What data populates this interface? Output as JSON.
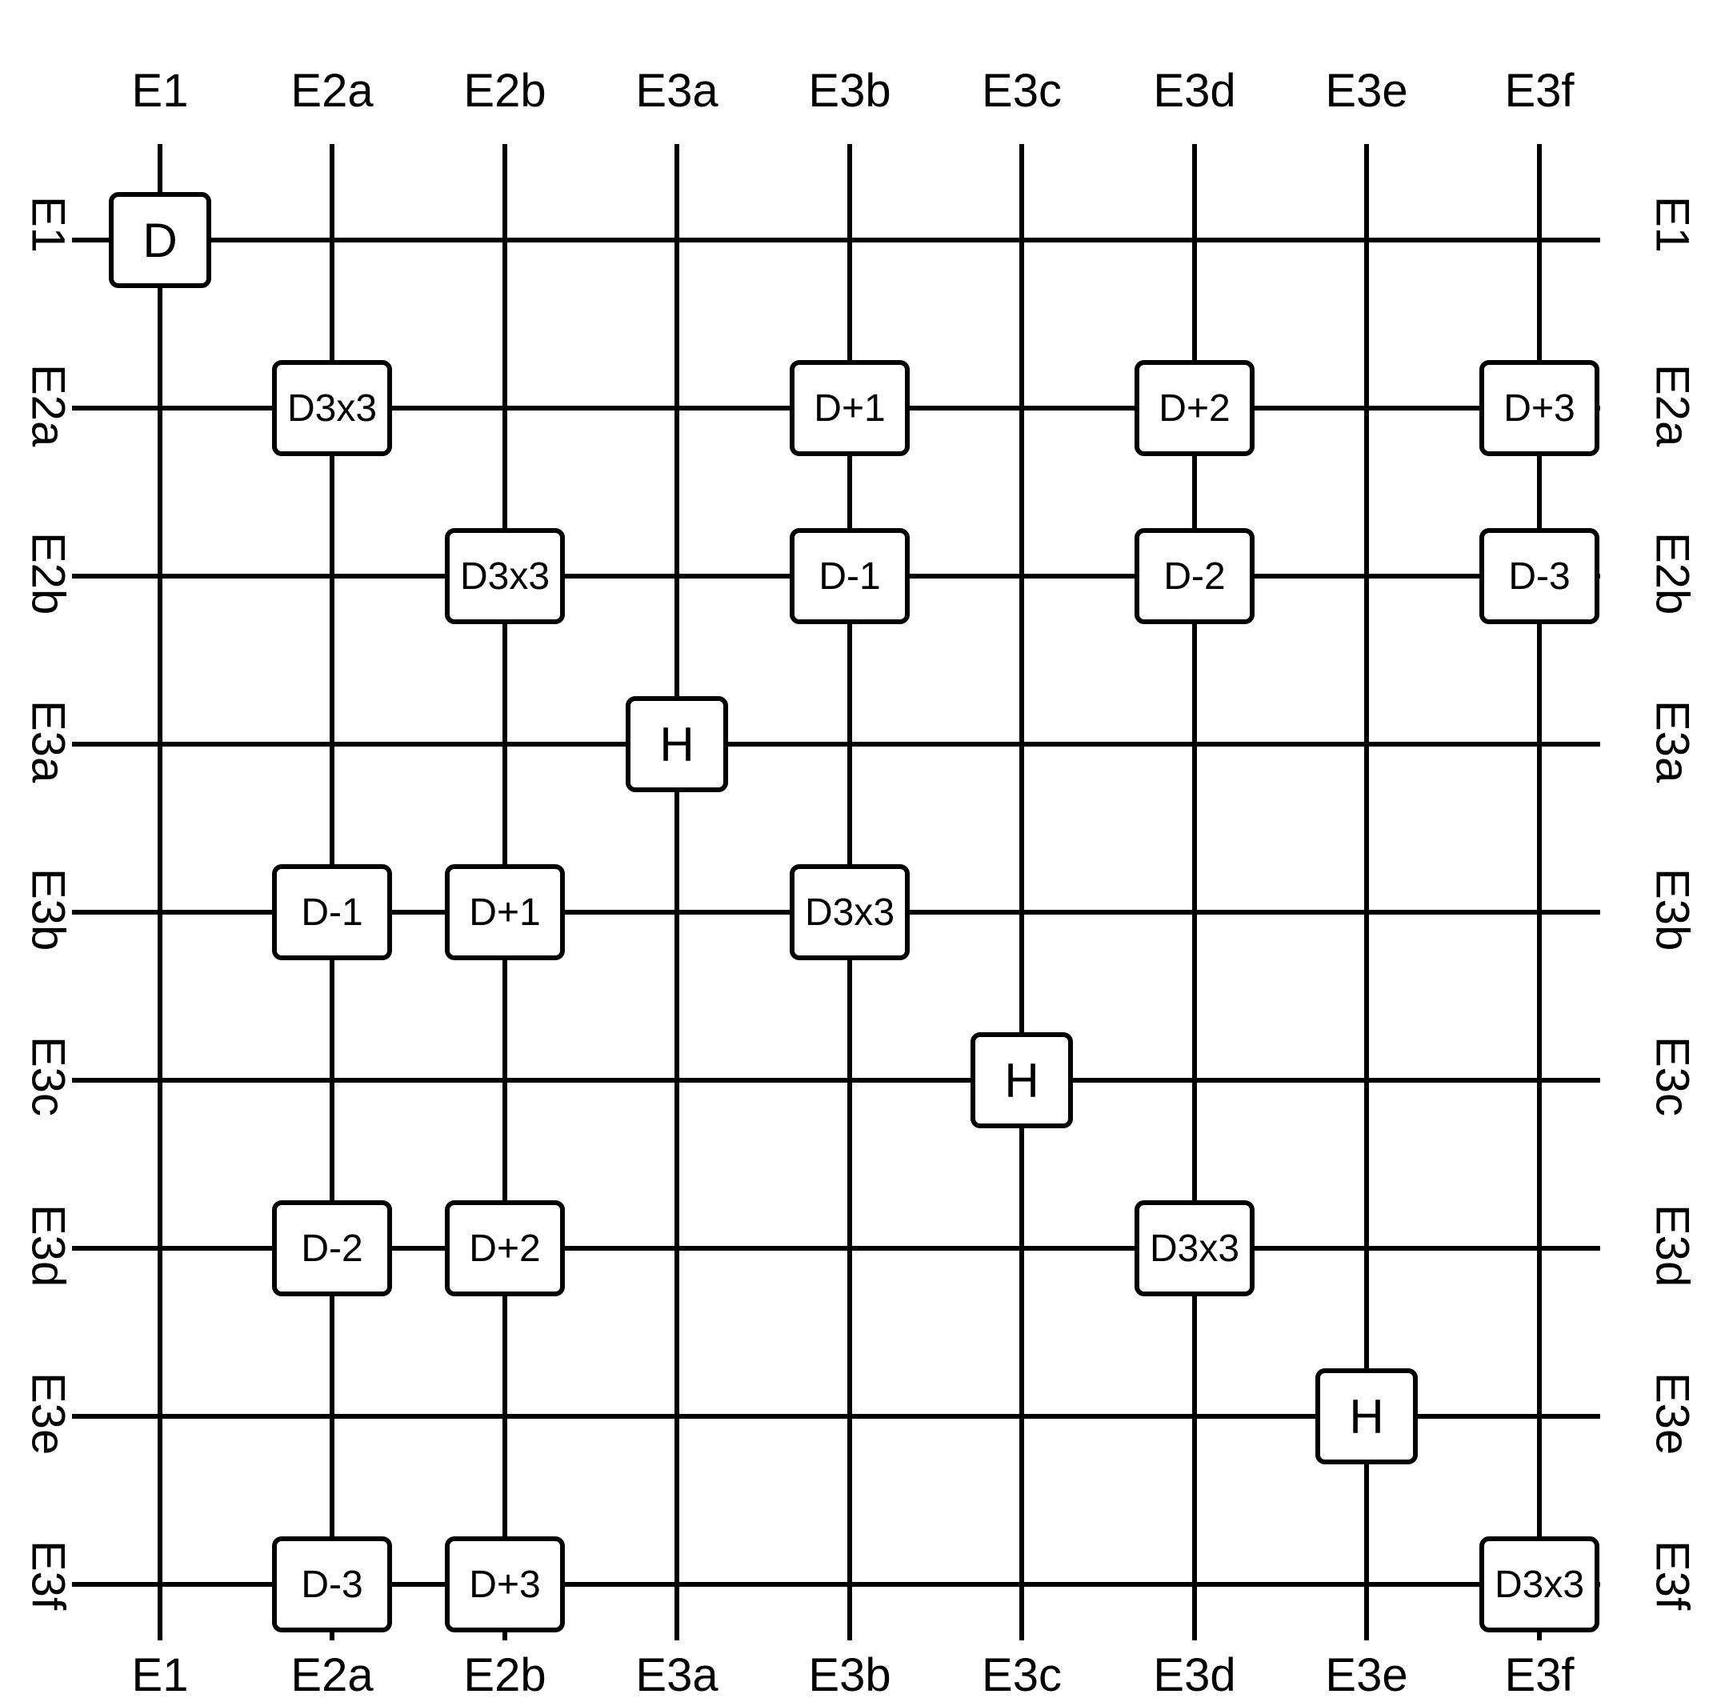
{
  "labels": [
    "E1",
    "E2a",
    "E2b",
    "E3a",
    "E3b",
    "E3c",
    "E3d",
    "E3e",
    "E3f"
  ],
  "colX": [
    200,
    415,
    631,
    846,
    1062,
    1277,
    1493,
    1708,
    1924
  ],
  "rowY": [
    300,
    510,
    720,
    930,
    1140,
    1350,
    1560,
    1770,
    1980
  ],
  "gridLeft": 90,
  "gridRight": 2000,
  "gridTop": 180,
  "gridBottom": 2050,
  "labelTopY": 80,
  "labelBottomY": 2060,
  "labelLeftX": 60,
  "labelRightX": 2090,
  "nodes": [
    {
      "r": 0,
      "c": 0,
      "t": "D",
      "big": true
    },
    {
      "r": 1,
      "c": 1,
      "t": "D3x3"
    },
    {
      "r": 1,
      "c": 4,
      "t": "D+1"
    },
    {
      "r": 1,
      "c": 6,
      "t": "D+2"
    },
    {
      "r": 1,
      "c": 8,
      "t": "D+3"
    },
    {
      "r": 2,
      "c": 2,
      "t": "D3x3"
    },
    {
      "r": 2,
      "c": 4,
      "t": "D-1"
    },
    {
      "r": 2,
      "c": 6,
      "t": "D-2"
    },
    {
      "r": 2,
      "c": 8,
      "t": "D-3"
    },
    {
      "r": 3,
      "c": 3,
      "t": "H",
      "big": true
    },
    {
      "r": 4,
      "c": 1,
      "t": "D-1"
    },
    {
      "r": 4,
      "c": 2,
      "t": "D+1"
    },
    {
      "r": 4,
      "c": 4,
      "t": "D3x3"
    },
    {
      "r": 5,
      "c": 5,
      "t": "H",
      "big": true
    },
    {
      "r": 6,
      "c": 1,
      "t": "D-2"
    },
    {
      "r": 6,
      "c": 2,
      "t": "D+2"
    },
    {
      "r": 6,
      "c": 6,
      "t": "D3x3"
    },
    {
      "r": 7,
      "c": 7,
      "t": "H",
      "big": true
    },
    {
      "r": 8,
      "c": 1,
      "t": "D-3"
    },
    {
      "r": 8,
      "c": 2,
      "t": "D+3"
    },
    {
      "r": 8,
      "c": 8,
      "t": "D3x3"
    }
  ]
}
